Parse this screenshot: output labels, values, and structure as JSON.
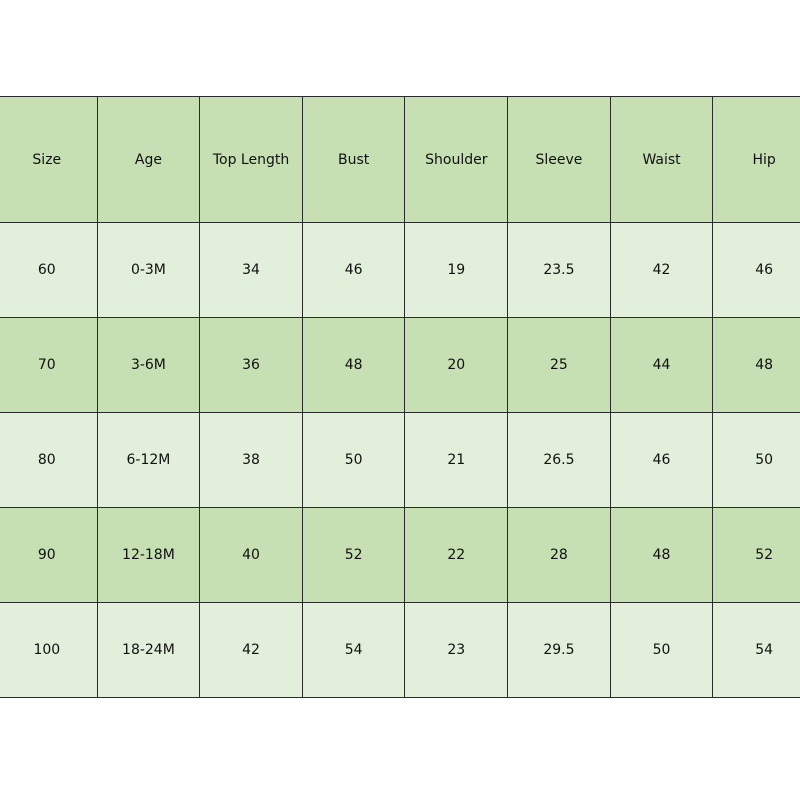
{
  "table": {
    "headers": [
      "Size",
      "Age",
      "Top Length",
      "Bust",
      "Shoulder",
      "Sleeve",
      "Waist",
      "Hip"
    ],
    "rows": [
      [
        "60",
        "0-3M",
        "34",
        "46",
        "19",
        "23.5",
        "42",
        "46"
      ],
      [
        "70",
        "3-6M",
        "36",
        "48",
        "20",
        "25",
        "44",
        "48"
      ],
      [
        "80",
        "6-12M",
        "38",
        "50",
        "21",
        "26.5",
        "46",
        "50"
      ],
      [
        "90",
        "12-18M",
        "40",
        "52",
        "22",
        "28",
        "48",
        "52"
      ],
      [
        "100",
        "18-24M",
        "42",
        "54",
        "23",
        "29.5",
        "50",
        "54"
      ]
    ],
    "colors": {
      "header": "#c6e0b4",
      "row_light": "#e2efda",
      "row_dark": "#c6e0b4",
      "border": "#2b2b2b"
    }
  }
}
